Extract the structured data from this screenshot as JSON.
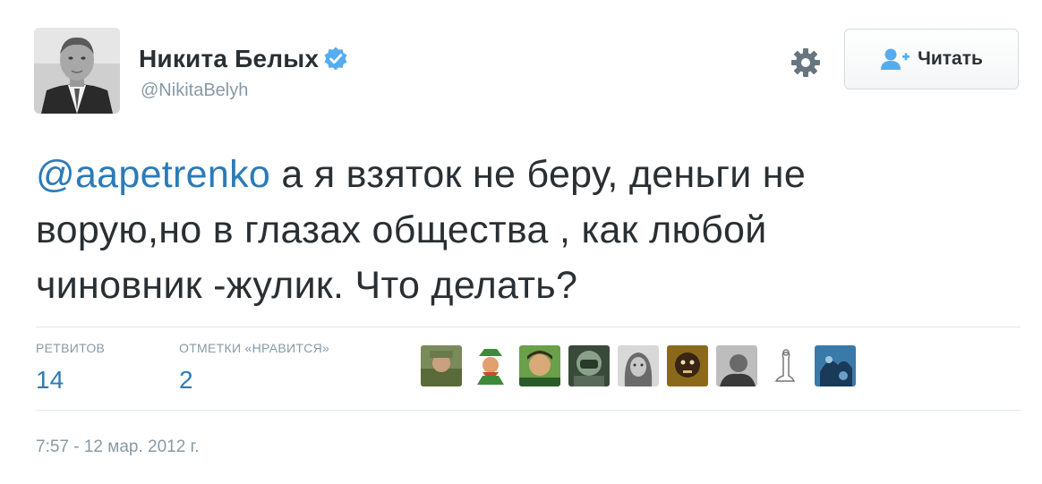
{
  "author": {
    "name": "Никита Белых",
    "handle": "@NikitaBelyh",
    "verified_icon": "verified-badge-icon",
    "avatar_icon": "profile-photo"
  },
  "actions": {
    "settings_icon": "gear-icon",
    "follow_label": "Читать",
    "follow_icon": "add-user-icon"
  },
  "tweet": {
    "mention": "@aapetrenko",
    "text_line1": " а я взяток не беру, деньги не",
    "text_line2": "ворую,но в глазах общества , как любой",
    "text_line3": "чиновник -жулик. Что делать?"
  },
  "stats": {
    "retweets_label": "РЕТВИТОВ",
    "retweets_value": "14",
    "likes_label": "ОТМЕТКИ «НРАВИТСЯ»",
    "likes_value": "2"
  },
  "likers_count_shown": 9,
  "timestamp": "7:57 - 12 мар. 2012 г.",
  "colors": {
    "link": "#2b7bb9",
    "verified": "#55acee",
    "muted": "#8899a6",
    "text": "#292f33",
    "divider": "#e1e8ed"
  }
}
